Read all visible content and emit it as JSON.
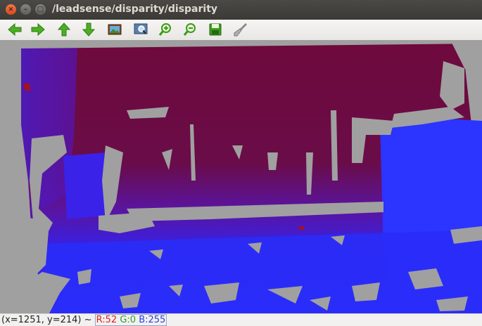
{
  "window": {
    "title": "/leadsense/disparity/disparity"
  },
  "toolbar": {
    "buttons": [
      {
        "name": "pan-left",
        "icon": "arrow-left-icon"
      },
      {
        "name": "pan-right",
        "icon": "arrow-right-icon"
      },
      {
        "name": "pan-up",
        "icon": "arrow-up-icon"
      },
      {
        "name": "pan-down",
        "icon": "arrow-down-icon"
      },
      {
        "name": "zoom-original",
        "icon": "picture-icon"
      },
      {
        "name": "zoom-fit",
        "icon": "zoom-frame-icon"
      },
      {
        "name": "zoom-in",
        "icon": "zoom-in-icon"
      },
      {
        "name": "zoom-out",
        "icon": "zoom-out-icon"
      },
      {
        "name": "save",
        "icon": "save-icon"
      },
      {
        "name": "properties",
        "icon": "brush-icon"
      }
    ]
  },
  "status": {
    "coords": "(x=1251, y=214) ~ ",
    "r": "R:52",
    "g": "G:0",
    "b": "B:255"
  },
  "colors": {
    "gray_background": "#a0a0a0",
    "far_red": "#6e0a3c",
    "mid_purple": "#5a14a0",
    "near_blue": "#2a28f0",
    "bright_blue": "#2c34ff"
  }
}
